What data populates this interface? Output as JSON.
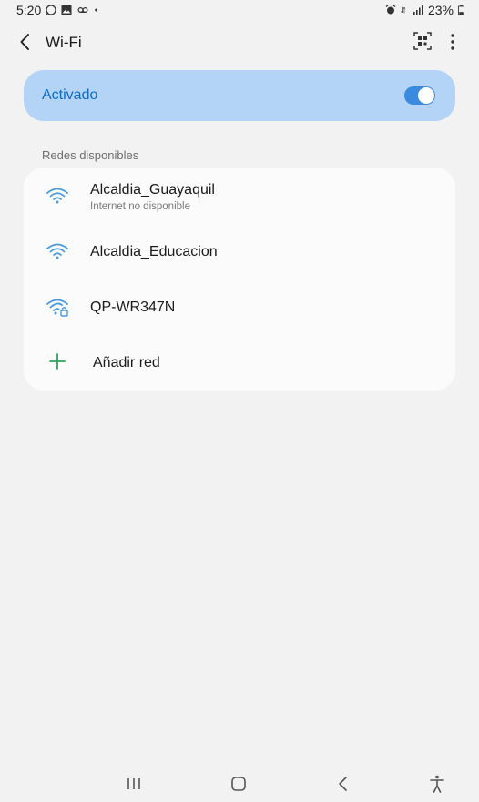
{
  "status": {
    "time": "5:20",
    "battery": "23%",
    "icons_left": [
      "whatsapp-icon",
      "image-icon",
      "voicemail-icon",
      "dot-icon"
    ],
    "icons_right": [
      "alarm-icon",
      "data-arrows-icon",
      "signal-icon",
      "battery-icon"
    ]
  },
  "header": {
    "title": "Wi-Fi",
    "icons": [
      "back-icon",
      "qr-scan-icon",
      "more-icon"
    ]
  },
  "wifi_toggle": {
    "label": "Activado",
    "state": "on",
    "accent": "#3a8ae0",
    "card_color": "#b3d3f7",
    "label_color": "#0b6cc4"
  },
  "networks": {
    "section_label": "Redes disponibles",
    "items": [
      {
        "name": "Alcaldia_Guayaquil",
        "status": "Internet no disponible",
        "icon": "wifi-icon",
        "secured": false
      },
      {
        "name": "Alcaldia_Educacion",
        "status": "",
        "icon": "wifi-icon",
        "secured": false
      },
      {
        "name": "QP-WR347N",
        "status": "",
        "icon": "wifi-lock-icon",
        "secured": true
      }
    ],
    "add": {
      "label": "Añadir red",
      "icon": "plus-icon",
      "color": "#2fa35a"
    }
  },
  "nav": {
    "icons": [
      "recents-icon",
      "home-icon",
      "back-nav-icon",
      "accessibility-icon"
    ]
  }
}
